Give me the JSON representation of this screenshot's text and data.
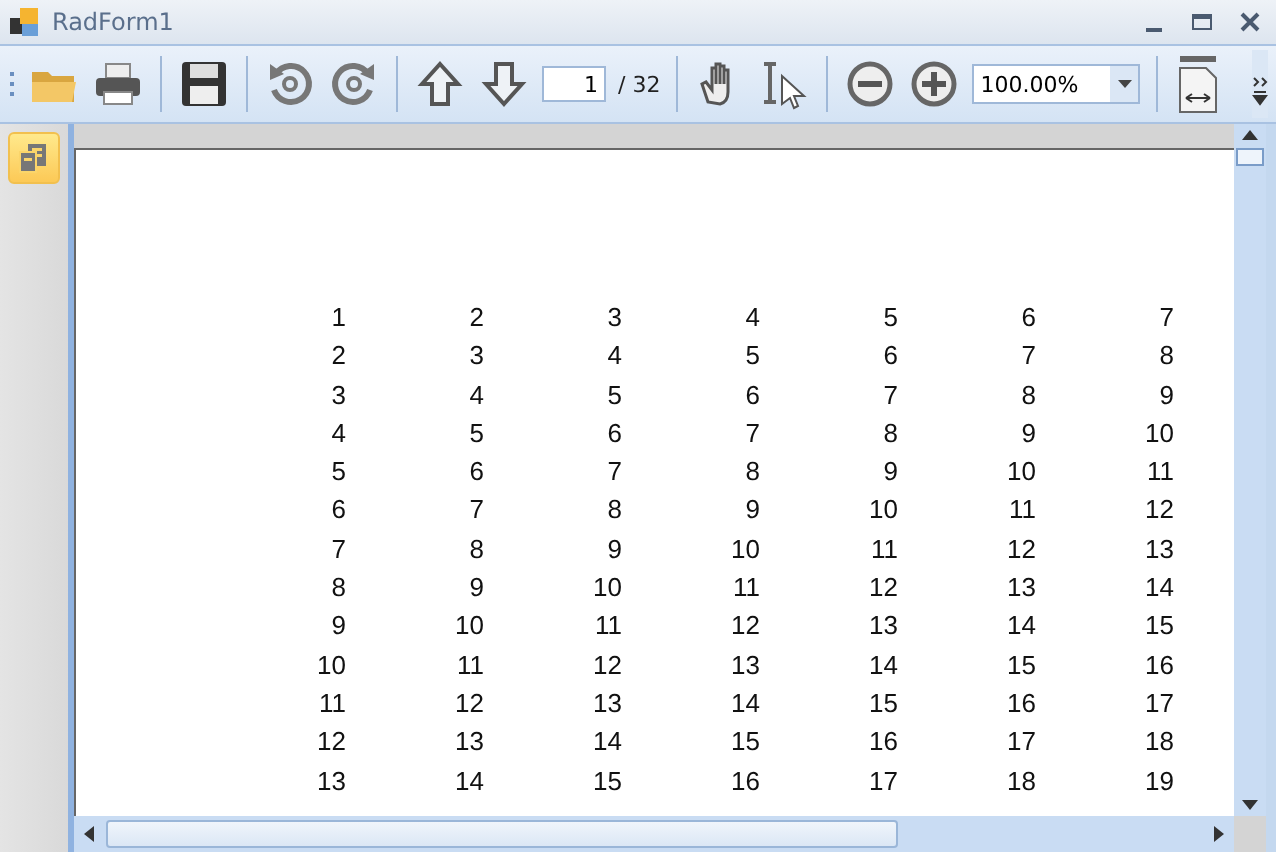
{
  "window": {
    "title": "RadForm1"
  },
  "toolbar": {
    "page_number": "1",
    "page_total": "/ 32",
    "zoom": "100.00%"
  },
  "report": {
    "rows": [
      [
        "1",
        "2",
        "3",
        "4",
        "5",
        "6",
        "7"
      ],
      [
        "2",
        "3",
        "4",
        "5",
        "6",
        "7",
        "8"
      ],
      [
        "3",
        "4",
        "5",
        "6",
        "7",
        "8",
        "9"
      ],
      [
        "4",
        "5",
        "6",
        "7",
        "8",
        "9",
        "10"
      ],
      [
        "5",
        "6",
        "7",
        "8",
        "9",
        "10",
        "11"
      ],
      [
        "6",
        "7",
        "8",
        "9",
        "10",
        "11",
        "12"
      ],
      [
        "7",
        "8",
        "9",
        "10",
        "11",
        "12",
        "13"
      ],
      [
        "8",
        "9",
        "10",
        "11",
        "12",
        "13",
        "14"
      ],
      [
        "9",
        "10",
        "11",
        "12",
        "13",
        "14",
        "15"
      ],
      [
        "10",
        "11",
        "12",
        "13",
        "14",
        "15",
        "16"
      ],
      [
        "11",
        "12",
        "13",
        "14",
        "15",
        "16",
        "17"
      ],
      [
        "12",
        "13",
        "14",
        "15",
        "16",
        "17",
        "18"
      ],
      [
        "13",
        "14",
        "15",
        "16",
        "17",
        "18",
        "19"
      ]
    ]
  }
}
